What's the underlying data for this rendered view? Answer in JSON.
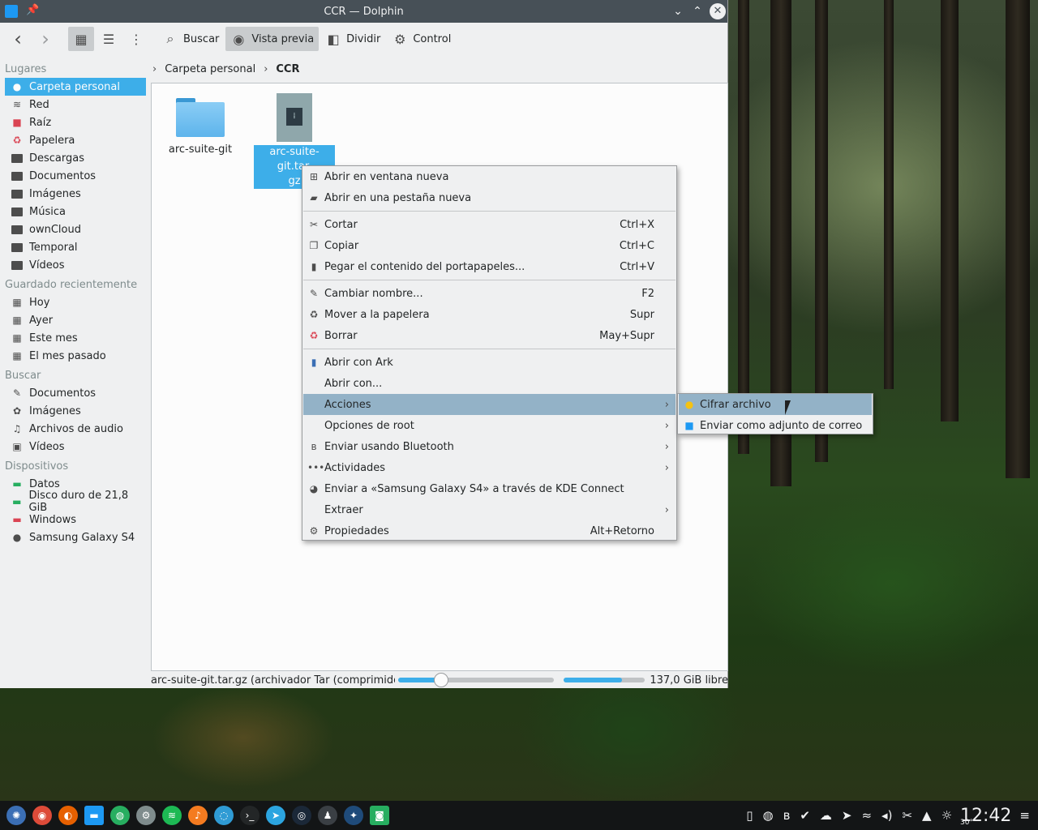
{
  "window": {
    "title": "CCR — Dolphin",
    "pin_glyph": "📌",
    "minimize_glyph": "⌄",
    "maximize_glyph": "⌃",
    "close_glyph": "✕"
  },
  "toolbar": {
    "back_glyph": "‹",
    "forward_glyph": "›",
    "icons_view_glyph": "▦",
    "compact_view_glyph": "☰",
    "details_view_glyph": "⋮",
    "search_label": "Buscar",
    "search_glyph": "⌕",
    "preview_label": "Vista previa",
    "preview_glyph": "◉",
    "split_label": "Dividir",
    "split_glyph": "◧",
    "control_label": "Control",
    "control_glyph": "⚙"
  },
  "sidebar": {
    "places_header": "Lugares",
    "places": [
      {
        "label": "Carpeta personal",
        "icon": "home-icon",
        "glyph": "●"
      },
      {
        "label": "Red",
        "icon": "network-icon",
        "glyph": "≋"
      },
      {
        "label": "Raíz",
        "icon": "root-folder-icon",
        "glyph": "■"
      },
      {
        "label": "Papelera",
        "icon": "trash-icon",
        "glyph": "♻"
      },
      {
        "label": "Descargas",
        "icon": "folder-icon",
        "glyph": ""
      },
      {
        "label": "Documentos",
        "icon": "folder-icon",
        "glyph": ""
      },
      {
        "label": "Imágenes",
        "icon": "folder-icon",
        "glyph": ""
      },
      {
        "label": "Música",
        "icon": "folder-icon",
        "glyph": ""
      },
      {
        "label": "ownCloud",
        "icon": "folder-icon",
        "glyph": ""
      },
      {
        "label": "Temporal",
        "icon": "folder-icon",
        "glyph": ""
      },
      {
        "label": "Vídeos",
        "icon": "folder-icon",
        "glyph": ""
      }
    ],
    "recent_header": "Guardado recientemente",
    "recent": [
      {
        "label": "Hoy",
        "glyph": "▦"
      },
      {
        "label": "Ayer",
        "glyph": "▦"
      },
      {
        "label": "Este mes",
        "glyph": "▦"
      },
      {
        "label": "El mes pasado",
        "glyph": "▦"
      }
    ],
    "search_header": "Buscar",
    "search": [
      {
        "label": "Documentos",
        "glyph": "✎"
      },
      {
        "label": "Imágenes",
        "glyph": "✿"
      },
      {
        "label": "Archivos de audio",
        "glyph": "♫"
      },
      {
        "label": "Vídeos",
        "glyph": "▣"
      }
    ],
    "devices_header": "Dispositivos",
    "devices": [
      {
        "label": "Datos",
        "glyph": "▬",
        "color": "#27ae60"
      },
      {
        "label": "Disco duro de 21,8 GiB",
        "glyph": "▬",
        "color": "#27ae60"
      },
      {
        "label": "Windows",
        "glyph": "▬",
        "color": "#da4453"
      },
      {
        "label": "Samsung Galaxy S4",
        "glyph": "●",
        "color": "#4d4d4d"
      }
    ]
  },
  "breadcrumb": {
    "lead_glyph": "›",
    "home": "Carpeta personal",
    "sep_glyph": "›",
    "current": "CCR"
  },
  "files": [
    {
      "name": "arc-suite-git",
      "type": "folder"
    },
    {
      "name_line1": "arc-suite-git.tar.",
      "name_line2": "gz",
      "type": "archive",
      "selected": true,
      "zip_glyph": "⁞"
    }
  ],
  "statusbar": {
    "text": "arc-suite-git.tar.gz (archivador Tar (comprimido ...",
    "zoom_fraction": 0.27,
    "used_fraction": 0.7,
    "free_text": "137,0 GiB libre"
  },
  "context_menu": {
    "items": [
      {
        "label": "Abrir en ventana nueva",
        "glyph": "⊞",
        "shortcut": "",
        "arrow": ""
      },
      {
        "label": "Abrir en una pestaña nueva",
        "glyph": "▰",
        "shortcut": "",
        "arrow": ""
      },
      {
        "label": "Cortar",
        "glyph": "✂",
        "shortcut": "Ctrl+X",
        "arrow": ""
      },
      {
        "label": "Copiar",
        "glyph": "❐",
        "shortcut": "Ctrl+C",
        "arrow": ""
      },
      {
        "label": "Pegar el contenido del portapapeles...",
        "glyph": "▮",
        "shortcut": "Ctrl+V",
        "arrow": ""
      },
      {
        "label": "Cambiar nombre...",
        "glyph": "✎",
        "shortcut": "F2",
        "arrow": ""
      },
      {
        "label": "Mover a la papelera",
        "glyph": "♻",
        "shortcut": "Supr",
        "arrow": ""
      },
      {
        "label": "Borrar",
        "glyph": "♻",
        "shortcut": "May+Supr",
        "arrow": ""
      },
      {
        "label": "Abrir con Ark",
        "glyph": "▮",
        "shortcut": "",
        "arrow": ""
      },
      {
        "label": "Abrir con...",
        "glyph": "",
        "shortcut": "",
        "arrow": ""
      },
      {
        "label": "Acciones",
        "glyph": "",
        "shortcut": "",
        "arrow": "›",
        "highlighted": true
      },
      {
        "label": "Opciones de root",
        "glyph": "",
        "shortcut": "",
        "arrow": "›"
      },
      {
        "label": "Enviar usando Bluetooth",
        "glyph": "ʙ",
        "shortcut": "",
        "arrow": "›"
      },
      {
        "label": "Actividades",
        "glyph": "•••",
        "shortcut": "",
        "arrow": "›"
      },
      {
        "label": "Enviar a «Samsung Galaxy S4» a través de KDE Connect",
        "glyph": "◕",
        "shortcut": "",
        "arrow": ""
      },
      {
        "label": "Extraer",
        "glyph": "",
        "shortcut": "",
        "arrow": "›"
      },
      {
        "label": "Propiedades",
        "glyph": "⚙",
        "shortcut": "Alt+Retorno",
        "arrow": ""
      }
    ]
  },
  "submenu": {
    "items": [
      {
        "label": "Cifrar archivo",
        "glyph": "●",
        "color": "#f5c211",
        "highlighted": true
      },
      {
        "label": "Enviar como adjunto de correo",
        "glyph": "■",
        "color": "#1d99f3"
      }
    ]
  },
  "taskbar": {
    "launchers": [
      {
        "name": "app-launcher-icon",
        "glyph": "✺",
        "color": "#3b6fb5"
      },
      {
        "name": "chrome-icon",
        "glyph": "◉",
        "color": "#dd4b39"
      },
      {
        "name": "firefox-icon",
        "glyph": "◐",
        "color": "#e66000"
      },
      {
        "name": "dolphin-icon",
        "glyph": "▬",
        "color": "#1d99f3"
      },
      {
        "name": "ghost-icon",
        "glyph": "◍",
        "color": "#27ae60"
      },
      {
        "name": "settings-icon",
        "glyph": "⚙",
        "color": "#7f8c8d"
      },
      {
        "name": "spotify-icon",
        "glyph": "≋",
        "color": "#1db954"
      },
      {
        "name": "music-icon",
        "glyph": "♪",
        "color": "#f47b20"
      },
      {
        "name": "browser-icon",
        "glyph": "◌",
        "color": "#2f9bd4"
      },
      {
        "name": "terminal-icon",
        "glyph": "›_",
        "color": "#232627"
      },
      {
        "name": "telegram-icon",
        "glyph": "➤",
        "color": "#2ca5e0"
      },
      {
        "name": "steam-icon",
        "glyph": "◎",
        "color": "#1b2838"
      },
      {
        "name": "contacts-icon",
        "glyph": "♟",
        "color": "#3a3f44"
      },
      {
        "name": "kodi-icon",
        "glyph": "✦",
        "color": "#1f4b7a"
      },
      {
        "name": "screenshot-icon",
        "glyph": "◙",
        "color": "#27ae60"
      }
    ],
    "tray": [
      {
        "name": "phone-tray-icon",
        "glyph": "▯"
      },
      {
        "name": "ghost-tray-icon",
        "glyph": "◍"
      },
      {
        "name": "bluetooth-tray-icon",
        "glyph": "ʙ"
      },
      {
        "name": "check-tray-icon",
        "glyph": "✔"
      },
      {
        "name": "cloud-tray-icon",
        "glyph": "☁"
      },
      {
        "name": "telegram-tray-icon",
        "glyph": "➤"
      },
      {
        "name": "wifi-tray-icon",
        "glyph": "≈"
      },
      {
        "name": "volume-tray-icon",
        "glyph": "◂)"
      },
      {
        "name": "clipboard-tray-icon",
        "glyph": "✂"
      },
      {
        "name": "expand-tray-icon",
        "glyph": "▲"
      },
      {
        "name": "weather-tray-icon",
        "glyph": "☼"
      }
    ],
    "temperature": "30°",
    "clock": "12:42",
    "menu_glyph": "≡"
  }
}
